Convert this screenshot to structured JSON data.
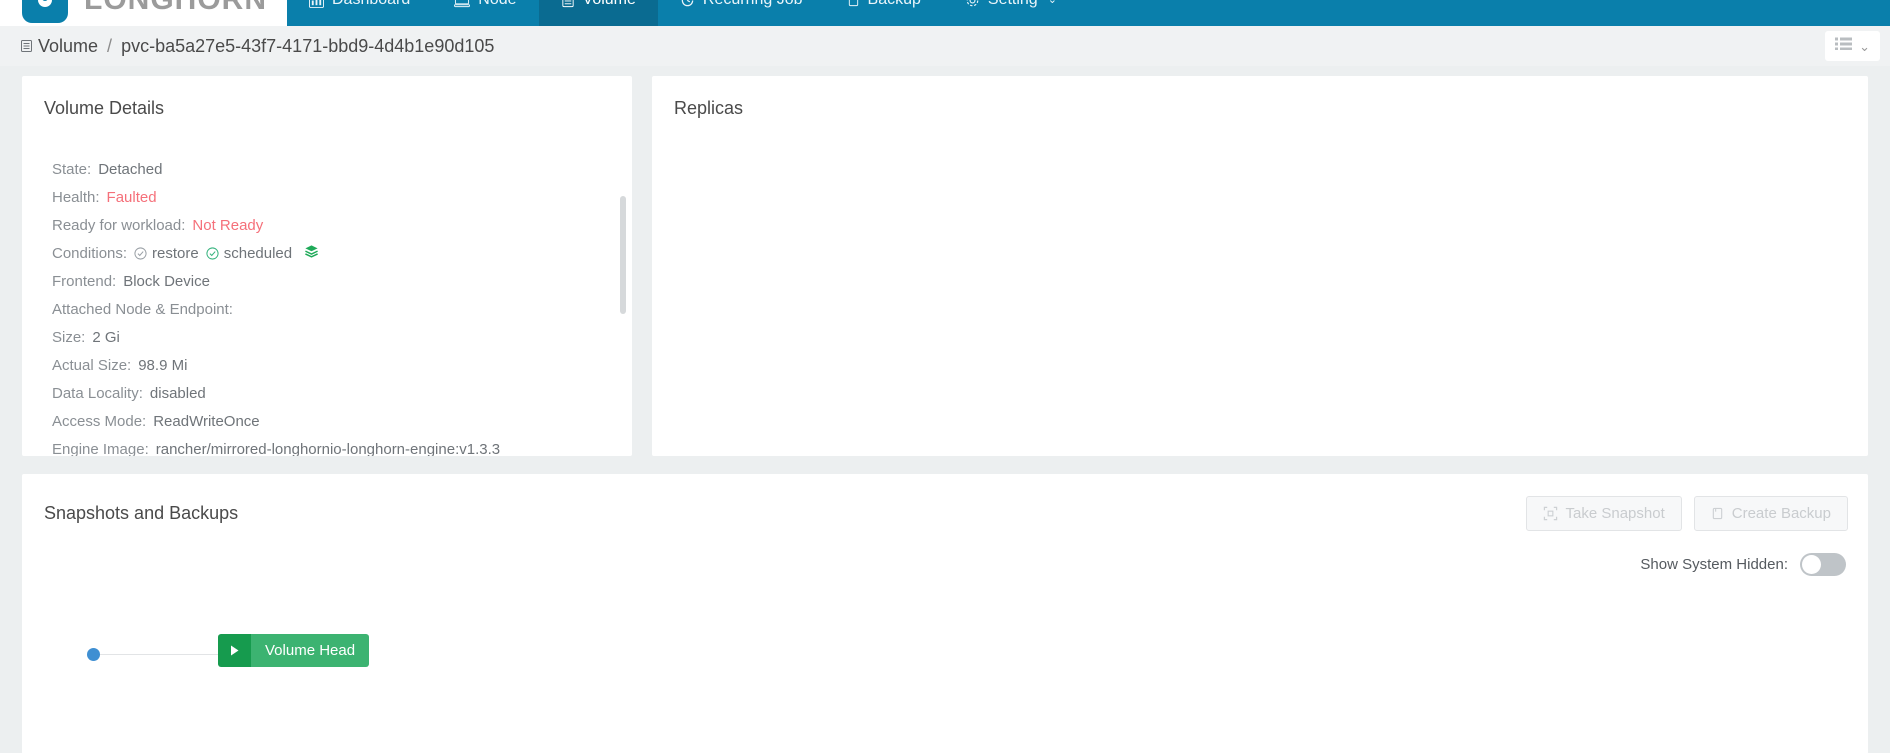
{
  "brand": {
    "name": "LONGHORN",
    "logo_icon": "longhorn-logo-icon"
  },
  "nav": {
    "items": [
      {
        "label": "Dashboard",
        "icon": "dashboard-icon",
        "active": false
      },
      {
        "label": "Node",
        "icon": "node-icon",
        "active": false
      },
      {
        "label": "Volume",
        "icon": "volume-icon",
        "active": true
      },
      {
        "label": "Recurring Job",
        "icon": "clock-icon",
        "active": false
      },
      {
        "label": "Backup",
        "icon": "backup-icon",
        "active": false
      },
      {
        "label": "Setting",
        "icon": "gear-icon",
        "active": false,
        "caret": "⌄"
      }
    ]
  },
  "breadcrumb": {
    "icon": "volume-list-icon",
    "root": "Volume",
    "separator": "/",
    "current": "pvc-ba5a27e5-43f7-4171-bbd9-4d4b1e90d105"
  },
  "view_toggle": {
    "icon": "list-view-icon",
    "chevron": "⌄"
  },
  "details": {
    "title": "Volume Details",
    "rows": [
      {
        "label": "State:",
        "value": "Detached",
        "status": "normal"
      },
      {
        "label": "Health:",
        "value": "Faulted",
        "status": "error"
      },
      {
        "label": "Ready for workload:",
        "value": "Not Ready",
        "status": "error"
      },
      {
        "label": "Conditions:",
        "value": "",
        "status": "conditions",
        "conditions": [
          {
            "name": "restore",
            "icon": "check-circle-icon",
            "color": "#9aa0a6"
          },
          {
            "name": "scheduled",
            "icon": "check-circle-icon",
            "color": "#36b37e"
          }
        ],
        "trailing_icon": "layers-icon",
        "trailing_color": "#1faa59"
      },
      {
        "label": "Frontend:",
        "value": "Block Device",
        "status": "normal"
      },
      {
        "label": "Attached Node & Endpoint:",
        "value": "",
        "status": "normal"
      },
      {
        "label": "Size:",
        "value": "2 Gi",
        "status": "normal"
      },
      {
        "label": "Actual Size:",
        "value": "98.9 Mi",
        "status": "normal"
      },
      {
        "label": "Data Locality:",
        "value": "disabled",
        "status": "normal"
      },
      {
        "label": "Access Mode:",
        "value": "ReadWriteOnce",
        "status": "normal"
      },
      {
        "label": "Engine Image:",
        "value": "rancher/mirrored-longhornio-longhorn-engine:v1.3.3",
        "status": "normal"
      }
    ]
  },
  "replicas": {
    "title": "Replicas"
  },
  "snapshots": {
    "title": "Snapshots and Backups",
    "take_snapshot_label": "Take Snapshot",
    "take_snapshot_icon": "snapshot-icon",
    "create_backup_label": "Create Backup",
    "create_backup_icon": "backup-icon",
    "show_system_hidden_label": "Show System Hidden:",
    "show_system_hidden_on": false,
    "volume_head_label": "Volume Head",
    "volume_head_icon": "play-icon"
  },
  "colors": {
    "brand_blue": "#0a7fab",
    "nav_active": "#0a6b91",
    "error_red": "#f5707a",
    "green_node": "#3cb371",
    "green_node_handle": "#169b4e",
    "dot_blue": "#3f8fd2"
  }
}
